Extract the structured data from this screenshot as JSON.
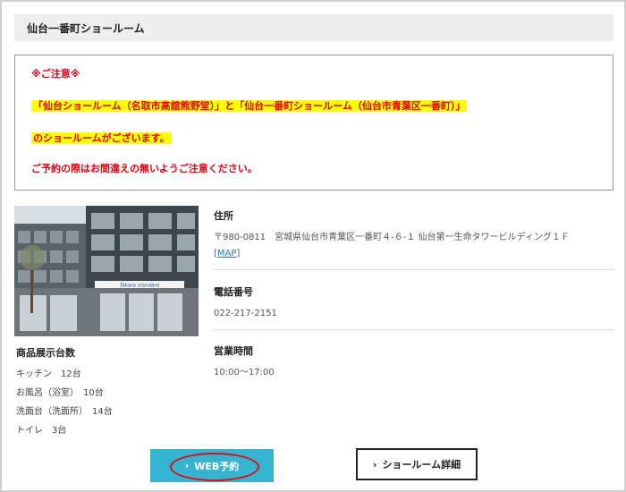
{
  "header": {
    "title": "仙台一番町ショールーム"
  },
  "notice": {
    "heading": "※ご注意※",
    "line1": "「仙台ショールーム（名取市高舘熊野堂）」と「仙台一番町ショールーム（仙台市青葉区一番町）」",
    "line2": "のショールームがございます。",
    "line3": "ご予約の際はお間違えの無いようご注意ください。"
  },
  "store_image": {
    "sign_text": "Takara standard"
  },
  "display_counts": {
    "title": "商品展示台数",
    "items": [
      "キッチン　12台",
      "お風呂（浴室）　10台",
      "洗面台（洗面所）　14台",
      "トイレ　3台"
    ]
  },
  "address": {
    "label": "住所",
    "value": "〒980-0811　宮城県仙台市青葉区一番町４-６-１ 仙台第一生命タワービルディング１Ｆ",
    "map_prefix": "[",
    "map_link": "MAP",
    "map_suffix": "]"
  },
  "phone": {
    "label": "電話番号",
    "value": "022-217-2151"
  },
  "hours": {
    "label": "営業時間",
    "value": "10:00〜17:00"
  },
  "buttons": {
    "chevron": "›",
    "web_reserve": "WEB予約",
    "showroom_detail": "ショールーム詳細"
  },
  "colors": {
    "accent": "#36b3d1",
    "warning_text": "#e60012",
    "highlight": "#ffff00",
    "annotation_circle": "#d3141c"
  }
}
